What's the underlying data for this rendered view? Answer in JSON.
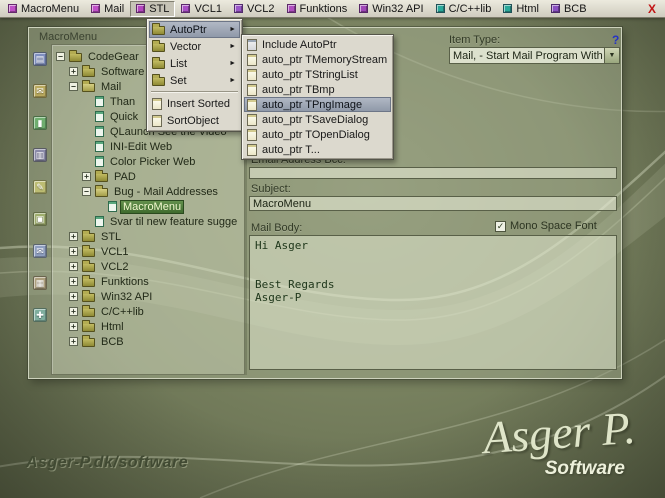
{
  "menubar": {
    "items": [
      {
        "label": "MacroMenu",
        "color": "#c050c8"
      },
      {
        "label": "Mail",
        "color": "#c050c8"
      },
      {
        "label": "STL",
        "color": "#b447bf",
        "open": true
      },
      {
        "label": "VCL1",
        "color": "#a84fc6"
      },
      {
        "label": "VCL2",
        "color": "#9a57c9"
      },
      {
        "label": "Funktions",
        "color": "#b04fc0"
      },
      {
        "label": "Win32 API",
        "color": "#a047b8"
      },
      {
        "label": "C/C++lib",
        "color": "#2aa89a"
      },
      {
        "label": "Html",
        "color": "#2aa89a"
      },
      {
        "label": "BCB",
        "color": "#8a50c2"
      }
    ],
    "close_glyph": "X"
  },
  "stl_menu": {
    "items": [
      {
        "label": "AutoPtr",
        "icon": "folder",
        "submenu": true,
        "highlighted": true
      },
      {
        "label": "Vector",
        "icon": "folder",
        "submenu": true
      },
      {
        "label": "List",
        "icon": "folder",
        "submenu": true
      },
      {
        "label": "Set",
        "icon": "folder",
        "submenu": true,
        "separator_after": true
      },
      {
        "label": "Insert Sorted",
        "icon": "doc"
      },
      {
        "label": "SortObject",
        "icon": "doc"
      }
    ]
  },
  "autoptr_menu": {
    "items": [
      {
        "label": "Include AutoPtr",
        "icon": "doc-gray"
      },
      {
        "label": "auto_ptr TMemoryStream",
        "icon": "doc"
      },
      {
        "label": "auto_ptr TStringList",
        "icon": "doc"
      },
      {
        "label": "auto_ptr TBmp",
        "icon": "doc"
      },
      {
        "label": "auto_ptr TPngImage",
        "icon": "doc",
        "highlighted": true
      },
      {
        "label": "auto_ptr TSaveDialog",
        "icon": "doc"
      },
      {
        "label": "auto_ptr TOpenDialog",
        "icon": "doc"
      },
      {
        "label": "auto_ptr T...",
        "icon": "doc"
      }
    ]
  },
  "window": {
    "title": "MacroMenu",
    "tree": [
      {
        "label": "CodeGear",
        "depth": 0,
        "icon": "folder",
        "expander": "minus"
      },
      {
        "label": "Software",
        "depth": 1,
        "icon": "folder",
        "expander": "plus"
      },
      {
        "label": "Mail",
        "depth": 1,
        "icon": "folder-open",
        "expander": "minus"
      },
      {
        "label": "Than",
        "depth": 2,
        "icon": "page",
        "expander": null
      },
      {
        "label": "Quick",
        "depth": 2,
        "icon": "page",
        "expander": null
      },
      {
        "label": "QLaunch See the Video",
        "depth": 2,
        "icon": "page",
        "expander": null
      },
      {
        "label": "INI-Edit Web",
        "depth": 2,
        "icon": "page",
        "expander": null
      },
      {
        "label": "Color Picker Web",
        "depth": 2,
        "icon": "page",
        "expander": null
      },
      {
        "label": "PAD",
        "depth": 2,
        "icon": "folder",
        "expander": "plus"
      },
      {
        "label": "Bug - Mail Addresses",
        "depth": 2,
        "icon": "folder-open",
        "expander": "minus"
      },
      {
        "label": "MacroMenu",
        "depth": 3,
        "icon": "page",
        "expander": null,
        "selected": true
      },
      {
        "label": "Svar til new feature sugge",
        "depth": 2,
        "icon": "page",
        "expander": null
      },
      {
        "label": "STL",
        "depth": 1,
        "icon": "folder",
        "expander": "plus"
      },
      {
        "label": "VCL1",
        "depth": 1,
        "icon": "folder",
        "expander": "plus"
      },
      {
        "label": "VCL2",
        "depth": 1,
        "icon": "folder",
        "expander": "plus"
      },
      {
        "label": "Funktions",
        "depth": 1,
        "icon": "folder",
        "expander": "plus"
      },
      {
        "label": "Win32 API",
        "depth": 1,
        "icon": "folder",
        "expander": "plus"
      },
      {
        "label": "C/C++lib",
        "depth": 1,
        "icon": "folder",
        "expander": "plus"
      },
      {
        "label": "Html",
        "depth": 1,
        "icon": "folder",
        "expander": "plus"
      },
      {
        "label": "BCB",
        "depth": 1,
        "icon": "folder",
        "expander": "plus"
      }
    ],
    "form": {
      "item_type_label": "Item Type:",
      "help_glyph": "?",
      "item_type_value": "Mail, - Start Mail Program With Rece",
      "bcc_label": "Email Address  Bcc:",
      "bcc_value": "",
      "subject_label": "Subject:",
      "subject_value": "MacroMenu",
      "mail_body_label": "Mail Body:",
      "mono_label": "Mono Space Font",
      "check_glyph": "✓",
      "mail_body_text": "Hi Asger\n\n\nBest Regards\nAsger-P"
    }
  },
  "toolbar": {
    "icons": [
      {
        "name": "notes-icon",
        "glyph": "▤",
        "color": "#7f8fc0"
      },
      {
        "name": "mail-icon",
        "glyph": "✉",
        "color": "#b9a95e"
      },
      {
        "name": "bookmark-icon",
        "glyph": "▮",
        "color": "#6fae6f"
      },
      {
        "name": "save-icon",
        "glyph": "▥",
        "color": "#8a8aa8"
      },
      {
        "name": "edit-icon",
        "glyph": "✎",
        "color": "#bcbc72"
      },
      {
        "name": "folder-icon",
        "glyph": "▣",
        "color": "#9fae6e"
      },
      {
        "name": "send-icon",
        "glyph": "✉",
        "color": "#8f9fc0"
      },
      {
        "name": "grid-icon",
        "glyph": "▦",
        "color": "#ad9f7d"
      },
      {
        "name": "tools-icon",
        "glyph": "✚",
        "color": "#7fae9e"
      }
    ]
  },
  "branding": {
    "website": "Asger-P.dk/software",
    "logo_script": "Asger P.",
    "logo_sub": "Software"
  }
}
